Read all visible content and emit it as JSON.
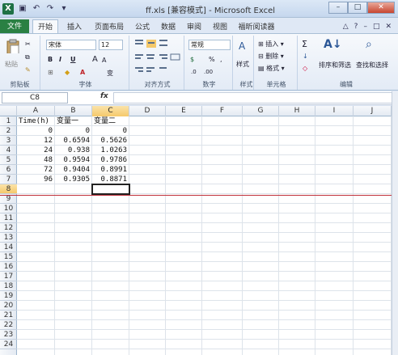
{
  "title": "ff.xls [兼容模式] - Microsoft Excel",
  "tabs": {
    "file": "文件",
    "items": [
      "开始",
      "插入",
      "页面布局",
      "公式",
      "数据",
      "审阅",
      "视图",
      "福昕阅读器"
    ],
    "active": 0
  },
  "ribbon": {
    "clipboard": {
      "label": "剪贴板",
      "paste": "粘贴"
    },
    "font": {
      "label": "字体",
      "name": "宋体",
      "size": "12",
      "bold": "B",
      "italic": "I",
      "underline": "U",
      "grow": "A",
      "shrink": "A",
      "wen": "变"
    },
    "alignment": {
      "label": "对齐方式"
    },
    "number": {
      "label": "数字",
      "format": "常规",
      "percent": "%",
      "comma": ","
    },
    "styles": {
      "label": "样式",
      "name": "样式"
    },
    "cells": {
      "label": "单元格",
      "insert": "插入",
      "delete": "删除",
      "format": "格式"
    },
    "editing": {
      "label": "编辑",
      "sum": "Σ",
      "sort": "排序和筛选",
      "find": "查找和选择"
    }
  },
  "formula": {
    "namebox": "C8",
    "fx": "fx",
    "value": ""
  },
  "columns": [
    "A",
    "B",
    "C",
    "D",
    "E",
    "F",
    "G",
    "H",
    "I",
    "J"
  ],
  "selected_column": "C",
  "selected_row": 8,
  "rows": [
    "1",
    "2",
    "3",
    "4",
    "5",
    "6",
    "7",
    "8",
    "9",
    "10",
    "11",
    "12",
    "13",
    "14",
    "15",
    "16",
    "17",
    "18",
    "19",
    "20",
    "21",
    "22",
    "23",
    "24"
  ],
  "cells": {
    "header": [
      "Time(h)",
      "变量一",
      "变量二"
    ],
    "data": [
      [
        "0",
        "0",
        "0"
      ],
      [
        "12",
        "0.6594",
        "0.5626"
      ],
      [
        "24",
        "0.938",
        "1.0263"
      ],
      [
        "48",
        "0.9594",
        "0.9786"
      ],
      [
        "72",
        "0.9404",
        "0.8991"
      ],
      [
        "96",
        "0.9305",
        "0.8871"
      ]
    ]
  },
  "colors": {
    "file_tab": "#2a8043",
    "selection": "#f5c96b",
    "red_line": "#c0303a"
  }
}
